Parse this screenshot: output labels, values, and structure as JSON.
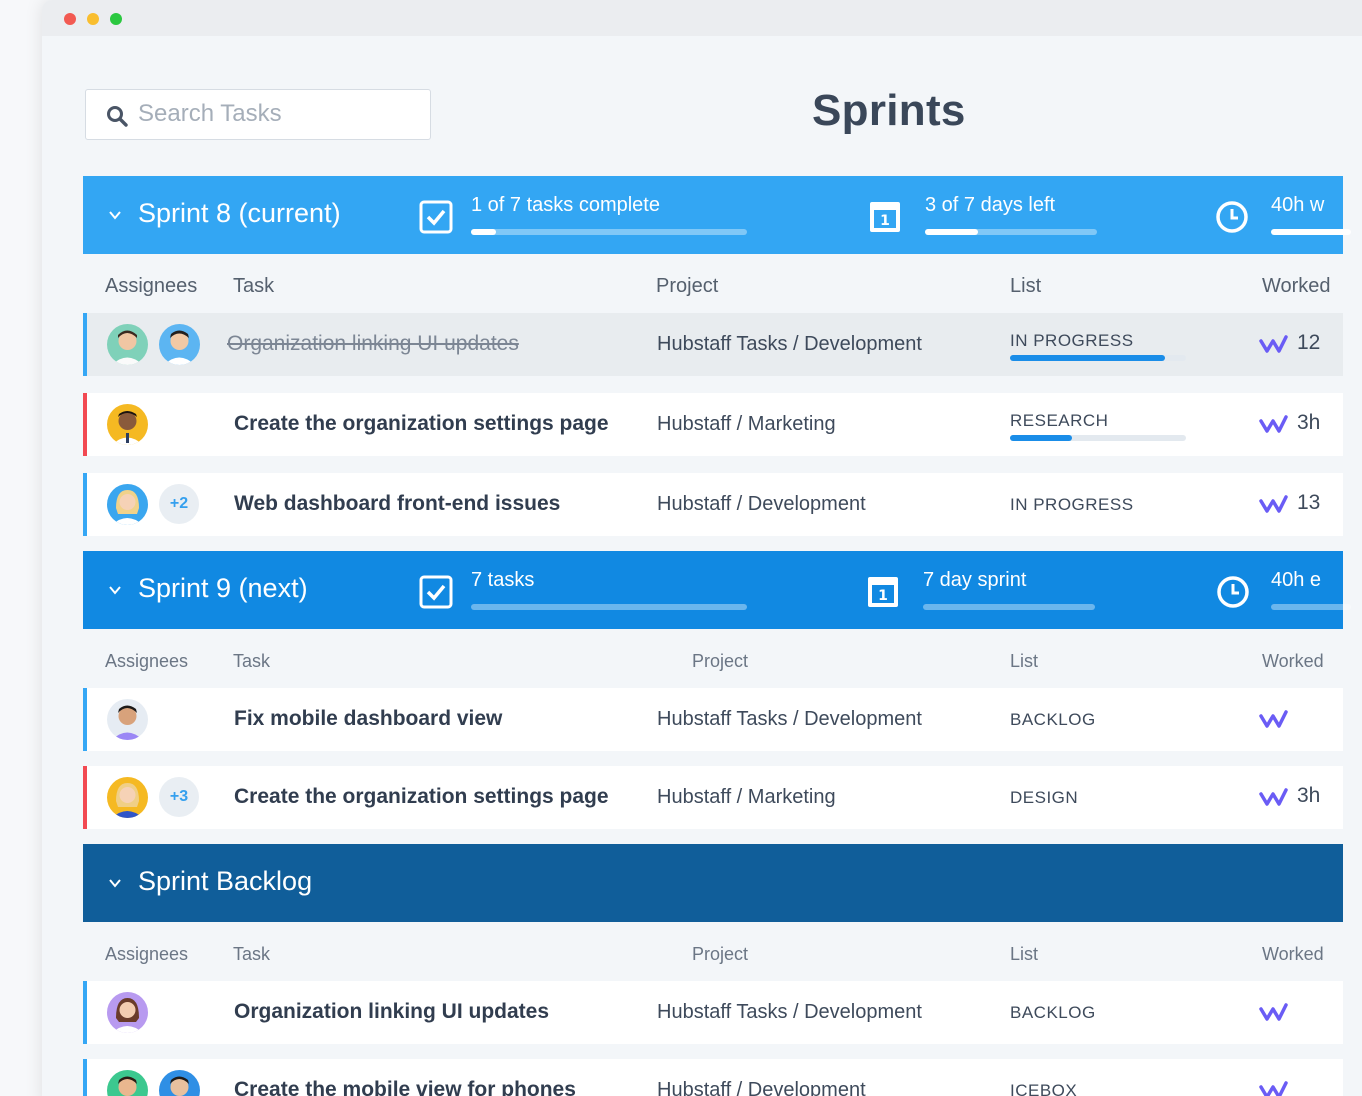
{
  "window": {
    "title": "Sprints"
  },
  "search": {
    "placeholder": "Search Tasks",
    "icon": "search-icon"
  },
  "columns": {
    "assignees": "Assignees",
    "task": "Task",
    "project": "Project",
    "list": "List",
    "worked": "Worked"
  },
  "sprints": [
    {
      "name": "Sprint 8 (current)",
      "tasks_label": "1 of 7 tasks complete",
      "tasks_progress": 0.09,
      "days_label": "3 of 7 days left",
      "days_progress": 0.31,
      "hours_label": "40h w",
      "rows": [
        {
          "task": "Organization linking UI updates",
          "project": "Hubstaff Tasks / Development",
          "list": "IN PROGRESS",
          "list_progress": 0.88,
          "worked": "12",
          "done": true,
          "flag": "blue",
          "extra_assignees": ""
        },
        {
          "task": "Create the organization settings page",
          "project": "Hubstaff / Marketing",
          "list": "RESEARCH",
          "list_progress": 0.35,
          "worked": "3h",
          "done": false,
          "flag": "red",
          "extra_assignees": ""
        },
        {
          "task": "Web dashboard front-end issues",
          "project": "Hubstaff / Development",
          "list": "IN PROGRESS",
          "worked": "13",
          "done": false,
          "flag": "blue",
          "extra_assignees": "+2"
        }
      ]
    },
    {
      "name": "Sprint 9 (next)",
      "tasks_label": "7 tasks",
      "tasks_progress": 0,
      "days_label": "7 day sprint",
      "days_progress": 0,
      "hours_label": "40h e",
      "rows": [
        {
          "task": "Fix mobile dashboard view",
          "project": "Hubstaff Tasks / Development",
          "list": "BACKLOG",
          "worked": "",
          "flag": "blue",
          "extra_assignees": ""
        },
        {
          "task": "Create the organization settings page",
          "project": "Hubstaff / Marketing",
          "list": "DESIGN",
          "worked": "3h",
          "flag": "red",
          "extra_assignees": "+3"
        }
      ]
    },
    {
      "name": "Sprint Backlog",
      "rows": [
        {
          "task": "Organization linking UI updates",
          "project": "Hubstaff Tasks / Development",
          "list": "BACKLOG",
          "worked": "",
          "flag": "blue",
          "extra_assignees": ""
        },
        {
          "task": "Create the mobile view for phones",
          "project": "Hubstaff / Development",
          "list": "ICEBOX",
          "worked": "",
          "flag": "blue",
          "extra_assignees": ""
        }
      ]
    }
  ],
  "colors": {
    "sprint_current": "#33a6f3",
    "sprint_next": "#1189e2",
    "sprint_backlog": "#105e9a",
    "flag_blue": "#35a7f5",
    "flag_red": "#f24952",
    "worked_icon": "#6a5cf5"
  }
}
